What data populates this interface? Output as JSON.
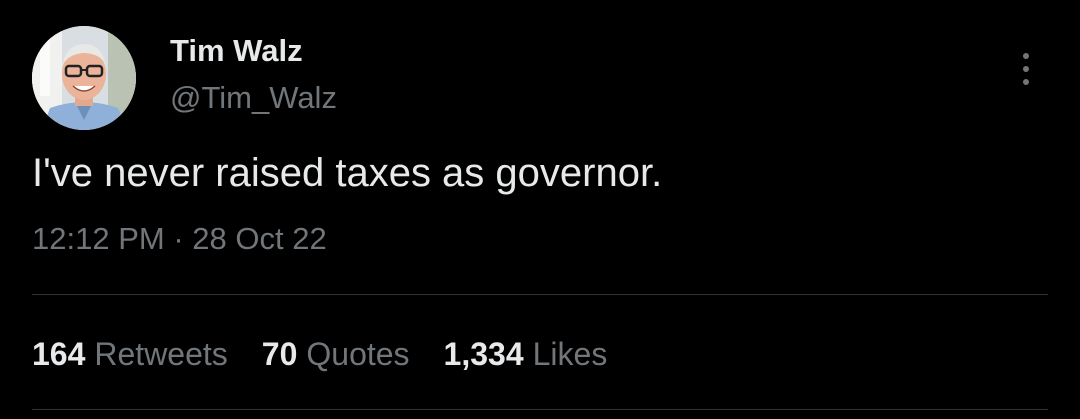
{
  "author": {
    "display_name": "Tim Walz",
    "handle": "@Tim_Walz",
    "avatar_icon": "profile-photo"
  },
  "tweet": {
    "text": "I've never raised taxes as governor.",
    "time": "12:12 PM",
    "separator": "·",
    "date": "28 Oct 22"
  },
  "stats": {
    "retweets": {
      "count": "164",
      "label": "Retweets"
    },
    "quotes": {
      "count": "70",
      "label": "Quotes"
    },
    "likes": {
      "count": "1,334",
      "label": "Likes"
    }
  },
  "menu": {
    "icon": "more-vertical-icon"
  },
  "colors": {
    "background": "#000000",
    "primary_text": "#e7e9ea",
    "secondary_text": "#71767b",
    "divider": "#2f3336"
  }
}
